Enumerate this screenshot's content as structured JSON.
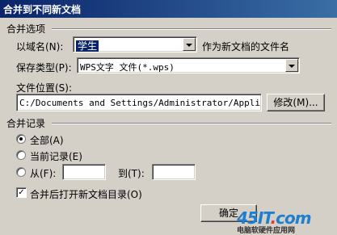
{
  "window": {
    "title": "合并到不同新文档"
  },
  "options_group": {
    "title": "合并选项",
    "field_name": {
      "label": "以域名(N):",
      "value": "学生",
      "suffix": "作为新文档的文件名"
    },
    "save_type": {
      "label": "保存类型(P):",
      "value": "WPS文字 文件(*.wps)"
    },
    "file_location": {
      "label": "文件位置(S):",
      "value": "C:/Documents and Settings/Administrator/Applicatio",
      "modify_button": "修改(M)..."
    }
  },
  "records_group": {
    "title": "合并记录",
    "all": "全部(A)",
    "current": "当前记录(E)",
    "from": "从(F):",
    "to": "到(T):",
    "from_value": "",
    "to_value": "",
    "selected": "all"
  },
  "open_dir_checkbox": {
    "label": "合并后打开新文档目录(O)",
    "checked": true,
    "mark": "✓"
  },
  "ok_button": "确定",
  "watermark": {
    "logo_main": "45IT",
    "logo_dot": ".",
    "logo_end": "com",
    "subtitle": "电脑软硬件应用网"
  },
  "colors": {
    "title_bar": "#0a246a",
    "dialog_bg": "#d4d0c8",
    "selection": "#0a246a"
  }
}
